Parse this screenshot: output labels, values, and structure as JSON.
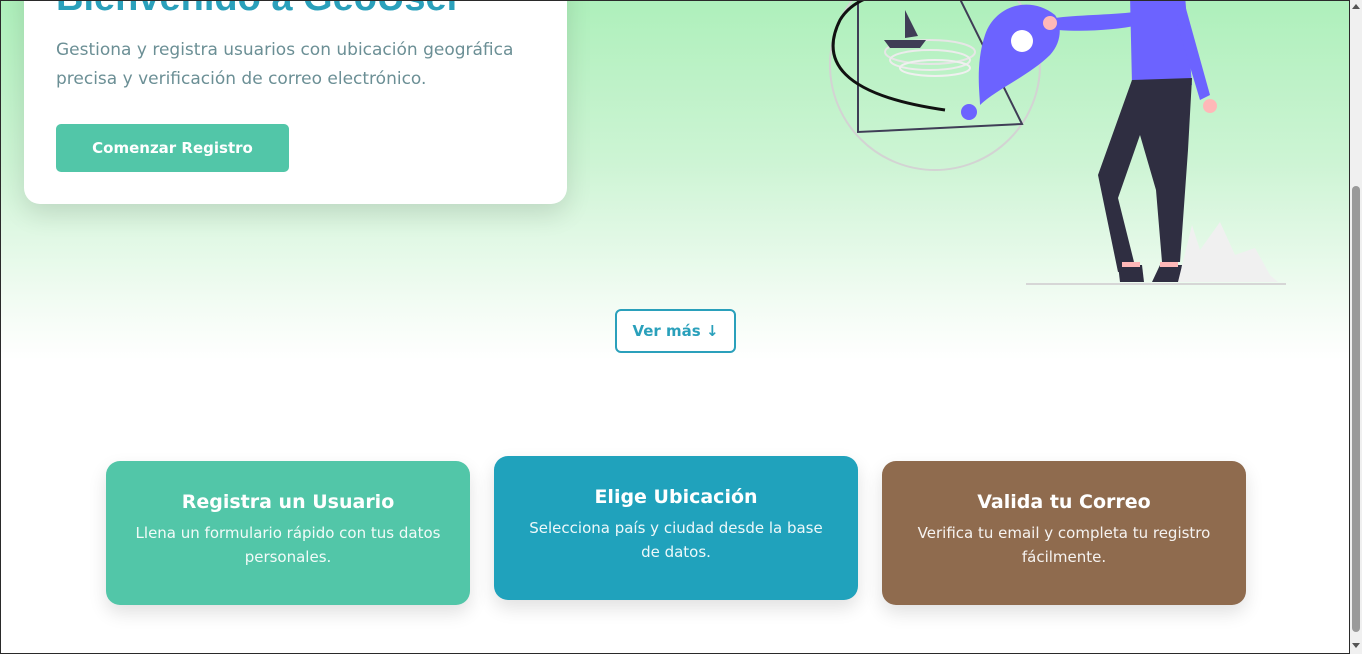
{
  "hero": {
    "title": "Bienvenido a GeoUser",
    "subtitle": "Gestiona y registra usuarios con ubicación geográfica precisa y verificación de correo electrónico.",
    "cta_label": "Comenzar Registro",
    "more_label": "Ver más ↓"
  },
  "features": [
    {
      "title": "Registra un Usuario",
      "text": "Llena un formulario rápido con tus datos personales.",
      "color": "#52c6a8"
    },
    {
      "title": "Elige Ubicación",
      "text": "Selecciona país y ciudad desde la base de datos.",
      "color": "#20a2bc"
    },
    {
      "title": "Valida tu Correo",
      "text": "Verifica tu email y completa tu registro fácilmente.",
      "color": "#8f6b4e"
    }
  ],
  "colors": {
    "accent": "#2aa0bb",
    "primary": "#52c6a8",
    "hero_bg": "#aef0bb",
    "illustration_purple": "#6c63ff",
    "illustration_dark": "#2f2e41"
  },
  "icons": [
    "location-pin-icon",
    "sailboat-icon",
    "person-illustration"
  ]
}
